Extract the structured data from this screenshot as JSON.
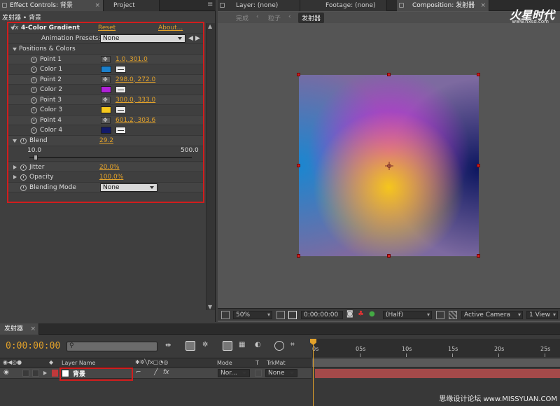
{
  "tabs": {
    "effect_controls": "Effect Controls: 背景",
    "project": "Project",
    "layer": "Layer: (none)",
    "footage": "Footage: (none)",
    "composition": "Composition: 发射器"
  },
  "effect_controls": {
    "breadcrumb": "发射器 • 背景",
    "effect_name": "4-Color Gradient",
    "fx_badge": "fx",
    "reset": "Reset",
    "about": "About...",
    "animation_presets_label": "Animation Presets:",
    "animation_presets_value": "None",
    "group_label": "Positions & Colors",
    "properties": [
      {
        "label": "Point 1",
        "type": "point",
        "value": "1.0, 301.0"
      },
      {
        "label": "Color 1",
        "type": "color",
        "color": "#1a80cc"
      },
      {
        "label": "Point 2",
        "type": "point",
        "value": "298.0, 272.0"
      },
      {
        "label": "Color 2",
        "type": "color",
        "color": "#b020d8"
      },
      {
        "label": "Point 3",
        "type": "point",
        "value": "300.0, 333.0"
      },
      {
        "label": "Color 3",
        "type": "color",
        "color": "#f5c81c"
      },
      {
        "label": "Point 4",
        "type": "point",
        "value": "601.2, 303.6"
      },
      {
        "label": "Color 4",
        "type": "color",
        "color": "#121a6a"
      }
    ],
    "blend_label": "Blend",
    "blend_value": "29.2",
    "blend_min": "10.0",
    "blend_max": "500.0",
    "blend_fraction": 0.039,
    "jitter_label": "Jitter",
    "jitter_value": "20.0%",
    "opacity_label": "Opacity",
    "opacity_value": "100.0%",
    "blending_mode_label": "Blending Mode",
    "blending_mode_value": "None"
  },
  "composition": {
    "subtabs": [
      "完成",
      "粒子",
      "发射器"
    ],
    "active_subtab": "发射器",
    "toolbar": {
      "zoom": "50%",
      "timecode": "0:00:00:00",
      "resolution": "(Half)",
      "camera": "Active Camera",
      "view": "1 View"
    }
  },
  "timeline": {
    "tab_label": "发射器",
    "timecode": "0:00:00:00",
    "column_layer_name": "Layer Name",
    "column_mode": "Mode",
    "column_t": "T",
    "column_trkmat": "TrkMat",
    "layer_name": "背景",
    "layer_mode": "Nor...",
    "layer_trkmat": "None",
    "layer_color": "#c0393b",
    "ruler_ticks": [
      "0s",
      "05s",
      "10s",
      "15s",
      "20s",
      "25s"
    ]
  },
  "watermark": {
    "brand": "火星时代",
    "url": "www.hxsd.com",
    "bottom": "思缘设计论坛 www.MISSYUAN.COM"
  }
}
